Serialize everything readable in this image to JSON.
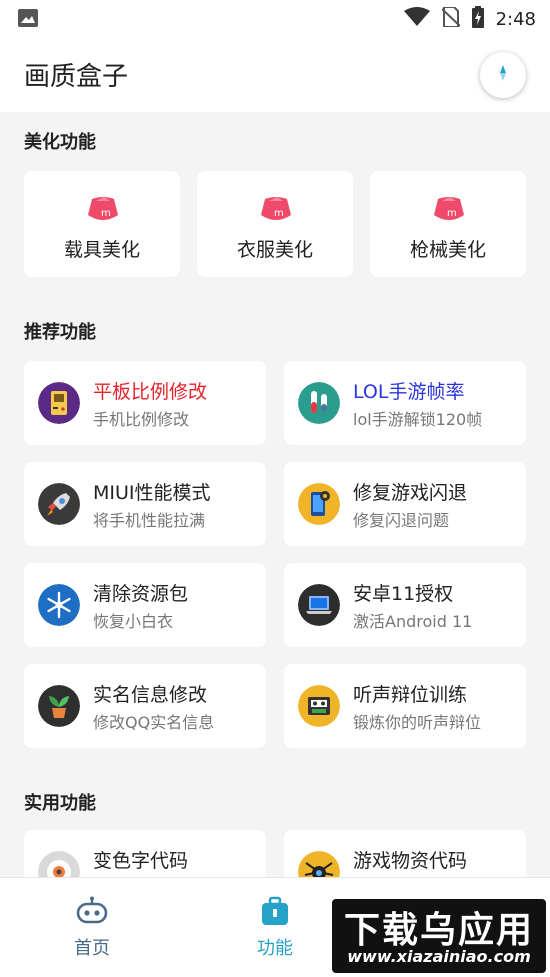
{
  "status_bar": {
    "time": "2:48",
    "icons": [
      "image-icon",
      "wifi-icon",
      "no-sim-icon",
      "battery-charging-icon"
    ]
  },
  "header": {
    "title": "画质盒子",
    "action_icon": "compass-icon"
  },
  "beauty": {
    "title": "美化功能",
    "items": [
      {
        "label": "载具美化",
        "icon": "m-logo-icon"
      },
      {
        "label": "衣服美化",
        "icon": "m-logo-icon"
      },
      {
        "label": "枪械美化",
        "icon": "m-logo-icon"
      }
    ]
  },
  "recommended": {
    "title": "推荐功能",
    "items": [
      {
        "title": "平板比例修改",
        "subtitle": "手机比例修改",
        "icon": "gameboy-icon",
        "accent": "#e8232a"
      },
      {
        "title": "LOL手游帧率",
        "subtitle": "lol手游解锁120帧",
        "icon": "test-tubes-icon",
        "accent": "#2a35e0"
      },
      {
        "title": "MIUI性能模式",
        "subtitle": "将手机性能拉满",
        "icon": "rocket-icon"
      },
      {
        "title": "修复游戏闪退",
        "subtitle": "修复闪退问题",
        "icon": "phone-gear-icon"
      },
      {
        "title": "清除资源包",
        "subtitle": "恢复小白衣",
        "icon": "snowflake-icon"
      },
      {
        "title": "安卓11授权",
        "subtitle": "激活Android 11",
        "icon": "laptop-icon"
      },
      {
        "title": "实名信息修改",
        "subtitle": "修改QQ实名信息",
        "icon": "plant-icon"
      },
      {
        "title": "听声辩位训练",
        "subtitle": "锻炼你的听声辩位",
        "icon": "cassette-icon"
      }
    ]
  },
  "utility": {
    "title": "实用功能",
    "items": [
      {
        "title": "变色字代码",
        "icon": "sushi-icon"
      },
      {
        "title": "游戏物资代码",
        "icon": "spider-icon"
      }
    ]
  },
  "bottom_nav": {
    "items": [
      {
        "label": "首页",
        "icon": "robot-icon"
      },
      {
        "label": "功能",
        "icon": "toolbox-icon",
        "active": true
      }
    ]
  },
  "watermark": {
    "title": "下载乌应用",
    "url": "www.xiazainiao.com"
  },
  "colors": {
    "accent_teal": "#26a2c8",
    "red": "#e8232a",
    "blue": "#2a35e0",
    "background": "#f4f4f4"
  }
}
